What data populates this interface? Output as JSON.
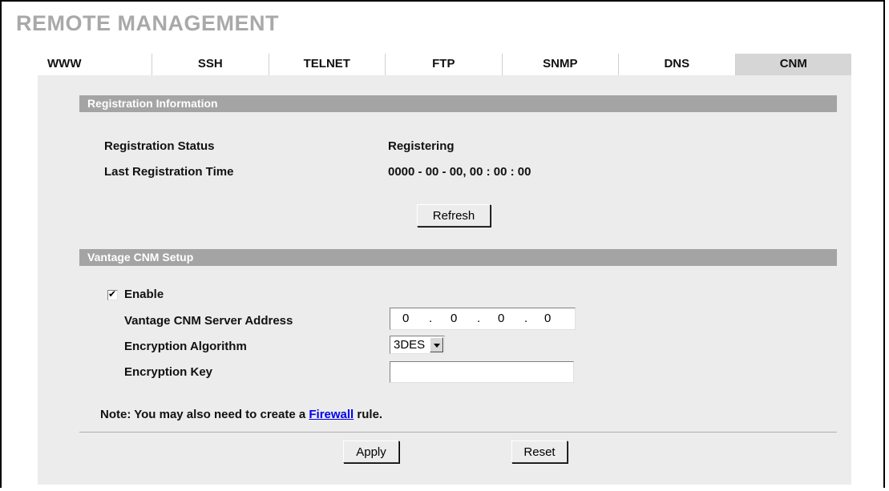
{
  "page": {
    "title": "REMOTE MANAGEMENT"
  },
  "tabs": [
    {
      "label": "WWW",
      "active": false
    },
    {
      "label": "SSH",
      "active": false
    },
    {
      "label": "TELNET",
      "active": false
    },
    {
      "label": "FTP",
      "active": false
    },
    {
      "label": "SNMP",
      "active": false
    },
    {
      "label": "DNS",
      "active": false
    },
    {
      "label": "CNM",
      "active": true
    }
  ],
  "registration": {
    "header": "Registration Information",
    "status_label": "Registration Status",
    "status_value": "Registering",
    "last_time_label": "Last Registration Time",
    "last_time_value": "0000 - 00 - 00, 00 : 00 : 00",
    "refresh_label": "Refresh"
  },
  "setup": {
    "header": "Vantage CNM Setup",
    "enable_label": "Enable",
    "enable_checked": true,
    "server_label": "Vantage CNM Server Address",
    "server_octets": [
      "0",
      "0",
      "0",
      "0"
    ],
    "algorithm_label": "Encryption Algorithm",
    "algorithm_value": "3DES",
    "key_label": "Encryption Key",
    "key_value": ""
  },
  "note": {
    "prefix": "Note: You may also need to create a ",
    "link": "Firewall",
    "suffix": " rule."
  },
  "actions": {
    "apply_label": "Apply",
    "reset_label": "Reset"
  },
  "colors": {
    "section_bar": "#a4a4a4",
    "panel_bg": "#ececec",
    "active_tab": "#d6d6d6",
    "title_gray": "#a9a9a9",
    "link": "#0000ee"
  }
}
